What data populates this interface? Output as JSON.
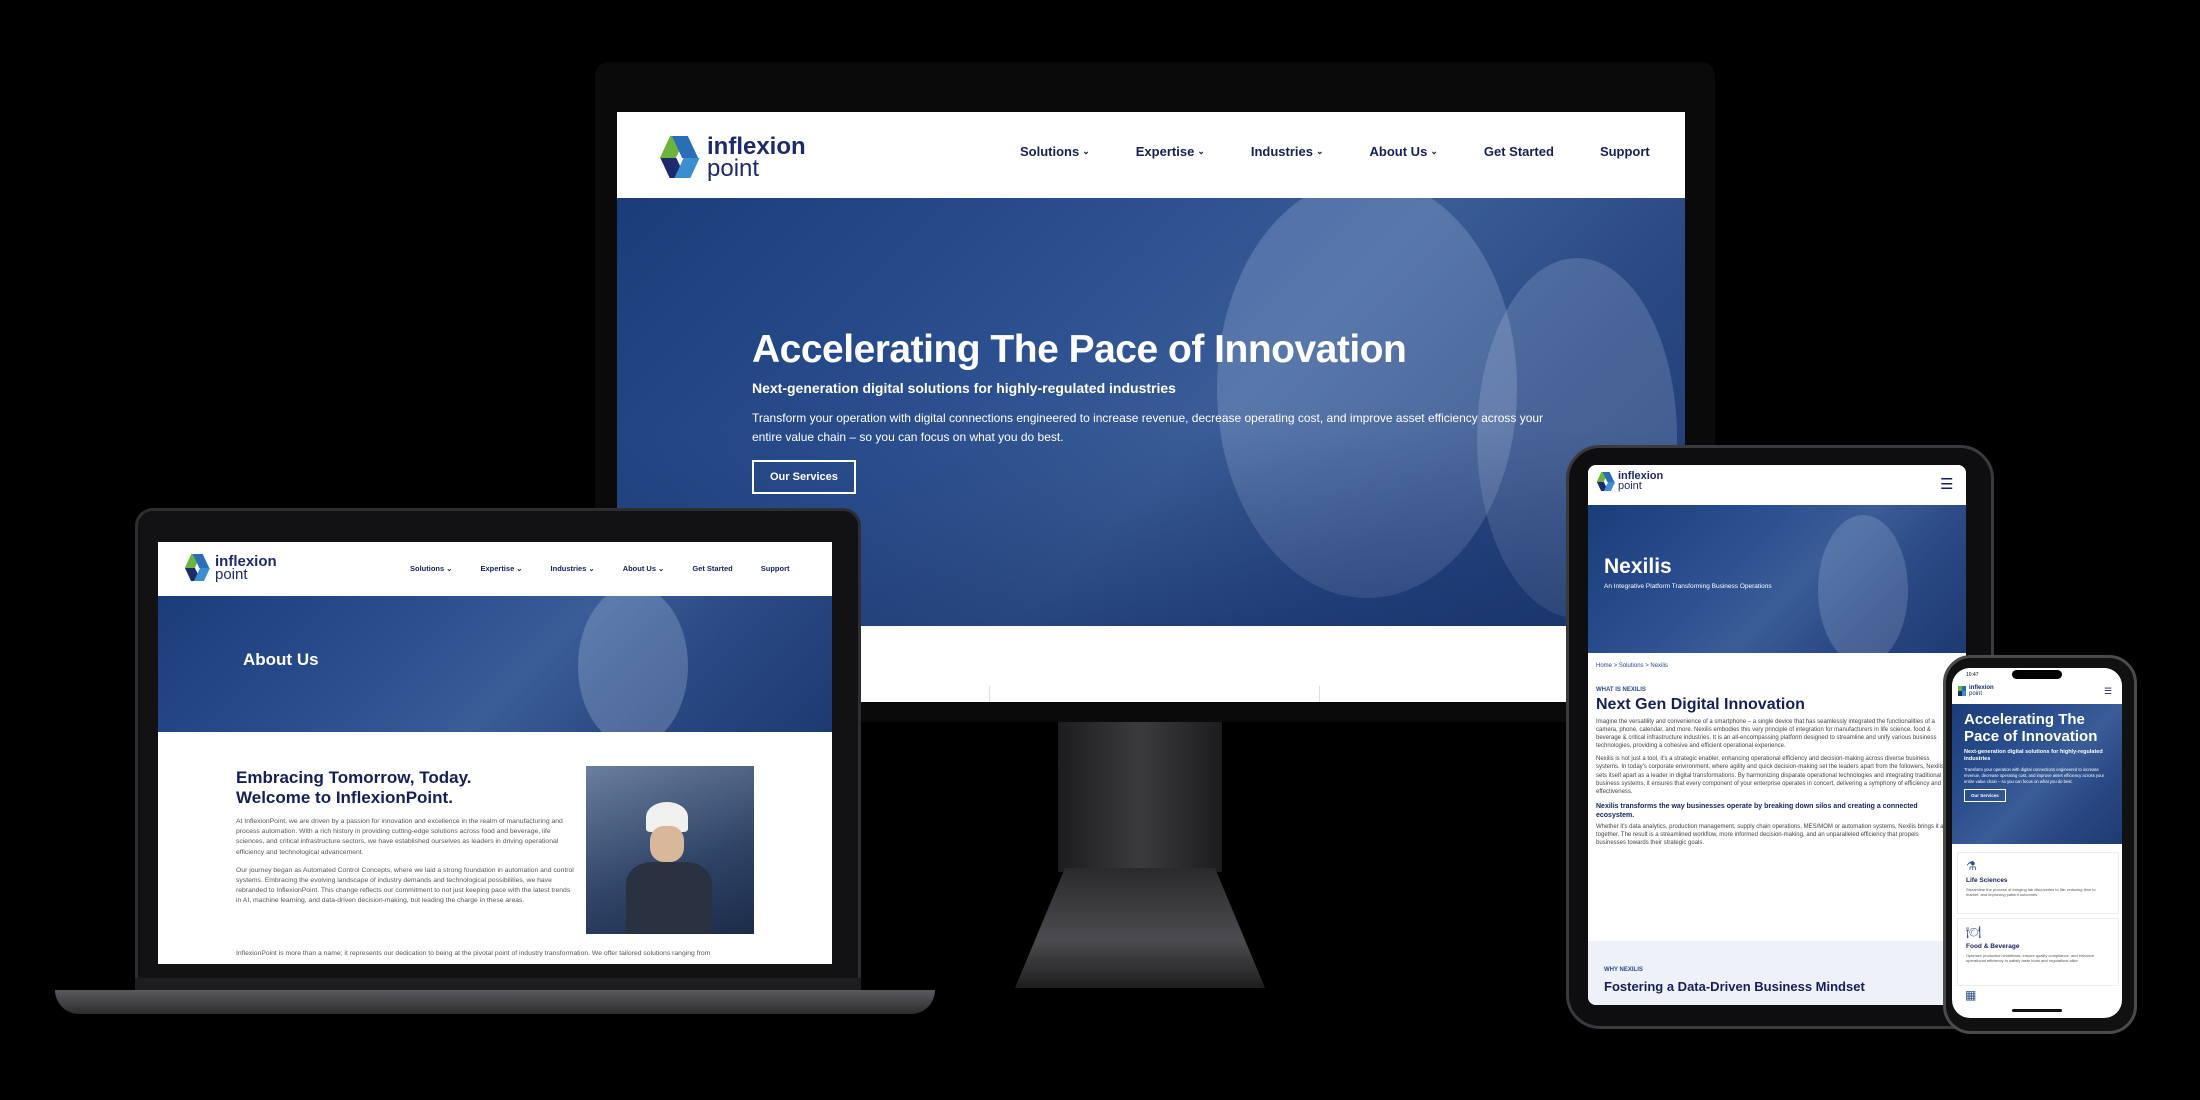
{
  "brand": {
    "name_line1": "inflexion",
    "name_line2": "point",
    "colors": {
      "navy": "#15205a",
      "green": "#6db33f",
      "blue": "#2a4a8a"
    }
  },
  "desktop": {
    "nav": [
      "Solutions",
      "Expertise",
      "Industries",
      "About Us",
      "Get Started",
      "Support"
    ],
    "hero": {
      "title": "Accelerating The Pace of Innovation",
      "subtitle": "Next-generation digital solutions for highly-regulated industries",
      "body": "Transform your operation with digital connections engineered to increase revenue, decrease operating cost, and improve asset efficiency across your entire value chain – so you can focus on what you do best.",
      "button": "Our Services"
    }
  },
  "laptop": {
    "nav": [
      "Solutions",
      "Expertise",
      "Industries",
      "About Us",
      "Get Started",
      "Support"
    ],
    "banner_title": "About Us",
    "heading_line1": "Embracing Tomorrow, Today.",
    "heading_line2": "Welcome to InflexionPoint.",
    "para1": "At InflexionPoint, we are driven by a passion for innovation and excellence in the realm of manufacturing and process automation. With a rich history in providing cutting-edge solutions across food and beverage, life sciences, and critical infrastructure sectors, we have established ourselves as leaders in driving operational efficiency and technological advancement.",
    "para2": "Our journey began as Automated Control Concepts, where we laid a strong foundation in automation and control systems. Embracing the evolving landscape of industry demands and technological possibilities, we have rebranded to InflexionPoint. This change reflects our commitment to not just keeping pace with the latest trends in AI, machine learning, and data-driven decision-making, but leading the charge in these areas.",
    "para3": "InflexionPoint is more than a name; it represents our dedication to being at the pivotal point of industry transformation. We offer tailored solutions ranging from"
  },
  "tablet": {
    "hero_title": "Nexilis",
    "hero_subtitle": "An Integrative Platform Transforming Business Operations",
    "breadcrumb": "Home > Solutions > Nexilis",
    "eyebrow": "WHAT IS NEXILIS",
    "heading": "Next Gen Digital Innovation",
    "para1": "Imagine the versatility and convenience of a smartphone – a single device that has seamlessly integrated the functionalities of a camera, phone, calendar, and more. Nexilis embodies this very principle of integration for manufacturers in life science, food & beverage & critical infrastructure industries. It is an all-encompassing platform designed to streamline and unify various business technologies, providing a cohesive and efficient operational experience.",
    "para2": "Nexilis is not just a tool, it's a strategic enabler, enhancing operational efficiency and decision-making across diverse business systems. In today's corporate environment, where agility and quick decision-making set the leaders apart from the followers, Nexilis sets itself apart as a leader in digital transformations. By harmonizing disparate operational technologies and integrating traditional business systems, it ensures that every component of your enterprise operates in concert, delivering a symphony of efficiency and effectiveness.",
    "bold": "Nexilis transforms the way businesses operate by breaking down silos and creating a connected ecosystem.",
    "para3": "Whether it's data analytics, production management, supply chain operations, MES/MOM or automation systems, Nexilis brings it all together. The result is a streamlined workflow, more informed decision-making, and an unparalleled efficiency that propels businesses towards their strategic goals.",
    "eyebrow2": "WHY NEXILIS",
    "heading2": "Fostering a Data-Driven Business Mindset"
  },
  "phone": {
    "time": "10:47",
    "hero_title": "Accelerating The Pace of Innovation",
    "hero_subtitle": "Next-generation digital solutions for highly-regulated industries",
    "hero_body": "Transform your operation with digital connections engineered to increase revenue, decrease operating cost, and improve asset efficiency across your entire value chain – so you can focus on what you do best.",
    "button": "Our Services",
    "card1_title": "Life Sciences",
    "card1_body": "Streamline the process of bringing lab discoveries to life, reducing time to market, and improving patient outcomes.",
    "card2_title": "Food & Beverage",
    "card2_body": "Optimize production workflows, ensure quality compliance, and enhance operational efficiency to satisfy taste buds and regulations alike."
  }
}
